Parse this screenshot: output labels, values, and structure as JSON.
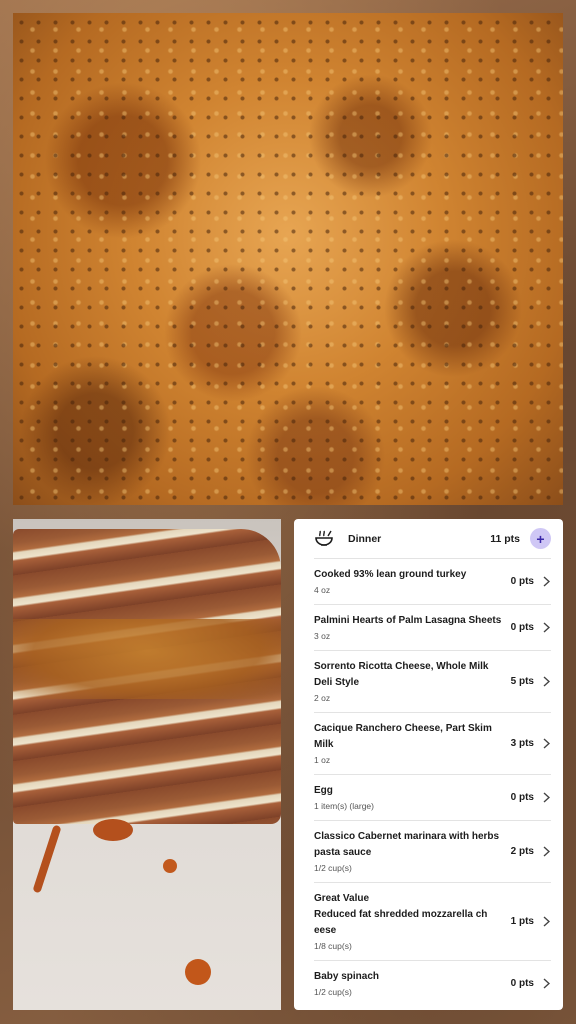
{
  "photos": {
    "top": {
      "subject": "lasagna-top-view"
    },
    "bottom": {
      "subject": "lasagna-slice"
    }
  },
  "meal": {
    "icon": "bowl-icon",
    "title": "Dinner",
    "total_points": "11 pts",
    "add_label": "+"
  },
  "items": [
    {
      "name": "Cooked 93% lean ground turkey",
      "qty": "4 oz",
      "points": "0 pts"
    },
    {
      "name": "Palmini Hearts of Palm Lasagna Sheets",
      "qty": "3 oz",
      "points": "0 pts"
    },
    {
      "name": "Sorrento Ricotta Cheese, Whole Milk Deli Style",
      "qty": "2 oz",
      "points": "5 pts"
    },
    {
      "name": "Cacique Ranchero Cheese, Part Skim Milk",
      "qty": "1 oz",
      "points": "3 pts"
    },
    {
      "name": "Egg",
      "qty": "1 item(s) (large)",
      "points": "0 pts"
    },
    {
      "name": "Classico Cabernet marinara with herbs pasta sauce",
      "qty": "1/2 cup(s)",
      "points": "2 pts"
    },
    {
      "name": "Great Value\nReduced fat shredded mozzarella ch eese",
      "qty": "1/8 cup(s)",
      "points": "1 pts"
    },
    {
      "name": "Baby spinach",
      "qty": "1/2 cup(s)",
      "points": "0 pts"
    }
  ],
  "colors": {
    "accent": "#cfc7f5",
    "accent_text": "#3a27a8"
  }
}
